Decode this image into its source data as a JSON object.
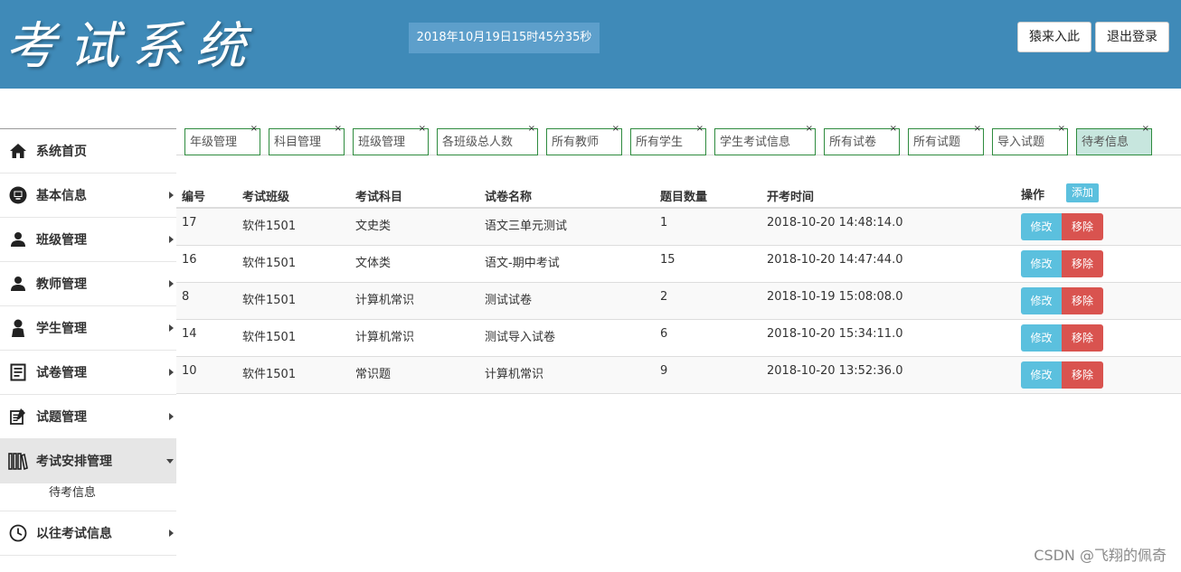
{
  "header": {
    "logo_text": "考试系统",
    "clock": "2018年10月19日15时45分35秒",
    "login_label": "猿来入此",
    "logout_label": "退出登录",
    "bg_color": "#3f8ab8"
  },
  "sidebar": {
    "items": [
      {
        "label": "系统首页",
        "icon": "home-icon",
        "has_arrow": false
      },
      {
        "label": "基本信息",
        "icon": "monitor-icon",
        "has_arrow": true
      },
      {
        "label": "班级管理",
        "icon": "user-icon",
        "has_arrow": true
      },
      {
        "label": "教师管理",
        "icon": "user-icon",
        "has_arrow": true
      },
      {
        "label": "学生管理",
        "icon": "person-icon",
        "has_arrow": true
      },
      {
        "label": "试卷管理",
        "icon": "document-icon",
        "has_arrow": true
      },
      {
        "label": "试题管理",
        "icon": "notepad-icon",
        "has_arrow": true
      },
      {
        "label": "考试安排管理",
        "icon": "books-icon",
        "expanded": true
      },
      {
        "label": "以往考试信息",
        "icon": "clock-icon",
        "has_arrow": true
      }
    ],
    "sub_item": "待考信息"
  },
  "tabs": [
    {
      "label": "年级管理",
      "close": "×"
    },
    {
      "label": "科目管理",
      "close": "×"
    },
    {
      "label": "班级管理",
      "close": "×"
    },
    {
      "label": "各班级总人数",
      "close": "×"
    },
    {
      "label": "所有教师",
      "close": "×"
    },
    {
      "label": "所有学生",
      "close": "×"
    },
    {
      "label": "学生考试信息",
      "close": "×"
    },
    {
      "label": "所有试卷",
      "close": "×"
    },
    {
      "label": "所有试题",
      "close": "×"
    },
    {
      "label": "导入试题",
      "close": "×"
    },
    {
      "label": "待考信息",
      "close": "×",
      "active": true
    }
  ],
  "table": {
    "headers": {
      "id": "编号",
      "class": "考试班级",
      "subject": "考试科目",
      "paper": "试卷名称",
      "count": "题目数量",
      "start": "开考时间",
      "ops": "操作"
    },
    "add_label": "添加",
    "edit_label": "修改",
    "delete_label": "移除",
    "rows": [
      {
        "id": "17",
        "class": "软件1501",
        "subject": "文史类",
        "paper": "语文三单元测试",
        "count": "1",
        "start": "2018-10-20 14:48:14.0"
      },
      {
        "id": "16",
        "class": "软件1501",
        "subject": "文体类",
        "paper": "语文-期中考试",
        "count": "15",
        "start": "2018-10-20 14:47:44.0"
      },
      {
        "id": "8",
        "class": "软件1501",
        "subject": "计算机常识",
        "paper": "测试试卷",
        "count": "2",
        "start": "2018-10-19 15:08:08.0"
      },
      {
        "id": "14",
        "class": "软件1501",
        "subject": "计算机常识",
        "paper": "测试导入试卷",
        "count": "6",
        "start": "2018-10-20 15:34:11.0"
      },
      {
        "id": "10",
        "class": "软件1501",
        "subject": "常识题",
        "paper": "计算机常识",
        "count": "9",
        "start": "2018-10-20 13:52:36.0"
      }
    ]
  },
  "watermark": "CSDN @飞翔的佩奇"
}
